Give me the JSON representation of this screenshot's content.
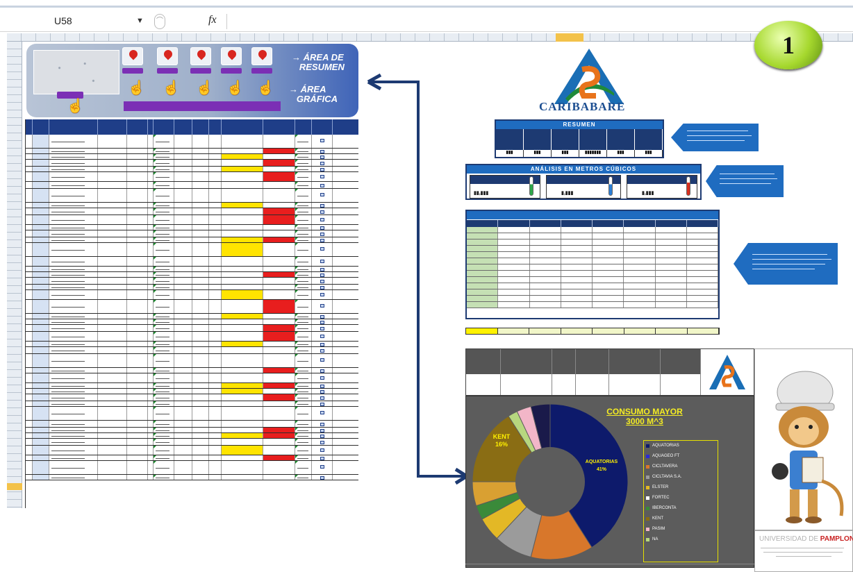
{
  "formula_bar": {
    "name_box": "U58",
    "fx_label": "fx"
  },
  "header_panel": {
    "link_resumen_line1": "ÁREA DE",
    "link_resumen_line2": "RESUMEN",
    "link_grafica_line1": "ÁREA",
    "link_grafica_line2": "GRÁFICA"
  },
  "badge": "1",
  "logo": {
    "name": "CARIBABARE"
  },
  "panels": {
    "resumen_title": "RESUMEN",
    "metros_title": "ANÁLISIS EN METROS CÚBICOS"
  },
  "chart": {
    "title_line1": "CONSUMO MAYOR",
    "title_line2": "3000 M^3",
    "label_kent": "KENT",
    "label_kent_pct": "16%",
    "label_aquatorias": "AQUATORIAS",
    "label_aquatorias_pct": "41%",
    "legend": [
      {
        "label": "AQUATORIAS",
        "color": "#0d1a6b"
      },
      {
        "label": "AQUAGEO FT",
        "color": "#2b2bd4"
      },
      {
        "label": "CICLTAVERA",
        "color": "#d8772b"
      },
      {
        "label": "CICLTAVIA S.A.",
        "color": "#9b9b9b"
      },
      {
        "label": "ELSTER",
        "color": "#e3b826"
      },
      {
        "label": "FORTEC",
        "color": "#ffffff"
      },
      {
        "label": "IBERCONTA",
        "color": "#3a8a3a"
      },
      {
        "label": "KENT",
        "color": "#8a6d14"
      },
      {
        "label": "PASIM",
        "color": "#f2b6c8"
      },
      {
        "label": "NA",
        "color": "#b7d77f"
      }
    ]
  },
  "university": {
    "prefix": "UNIVERSIDAD DE ",
    "name": "PAMPLONA"
  }
}
